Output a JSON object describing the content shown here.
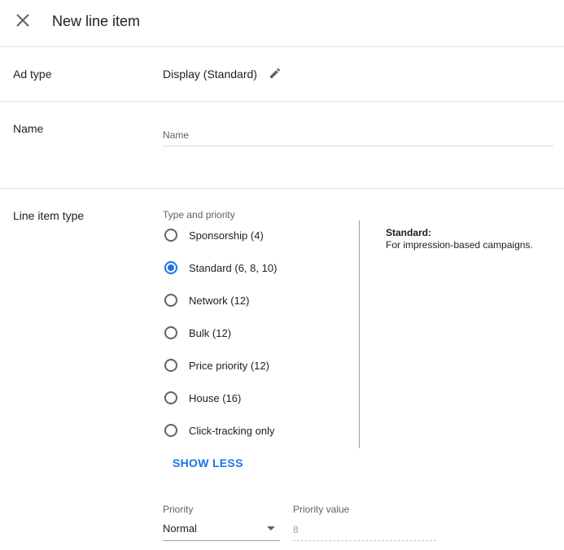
{
  "header": {
    "title": "New line item",
    "close_icon": "close-icon"
  },
  "ad_type": {
    "label": "Ad type",
    "value": "Display (Standard)",
    "edit_icon": "pencil-icon"
  },
  "name": {
    "label": "Name",
    "placeholder": "Name",
    "value": ""
  },
  "line_item_type": {
    "label": "Line item type",
    "group_caption": "Type and priority",
    "options": [
      {
        "label": "Sponsorship (4)",
        "checked": false
      },
      {
        "label": "Standard (6, 8, 10)",
        "checked": true
      },
      {
        "label": "Network (12)",
        "checked": false
      },
      {
        "label": "Bulk (12)",
        "checked": false
      },
      {
        "label": "Price priority (12)",
        "checked": false
      },
      {
        "label": "House (16)",
        "checked": false
      },
      {
        "label": "Click-tracking only",
        "checked": false
      }
    ],
    "description_title": "Standard:",
    "description_text": "For impression-based campaigns.",
    "show_less_label": "SHOW LESS"
  },
  "priority": {
    "label": "Priority",
    "selected": "Normal",
    "value_label": "Priority value",
    "value": "8"
  },
  "colors": {
    "accent": "#1a73e8",
    "text": "#202124",
    "secondary_text": "#5f6368",
    "divider": "#e0e0e0"
  }
}
